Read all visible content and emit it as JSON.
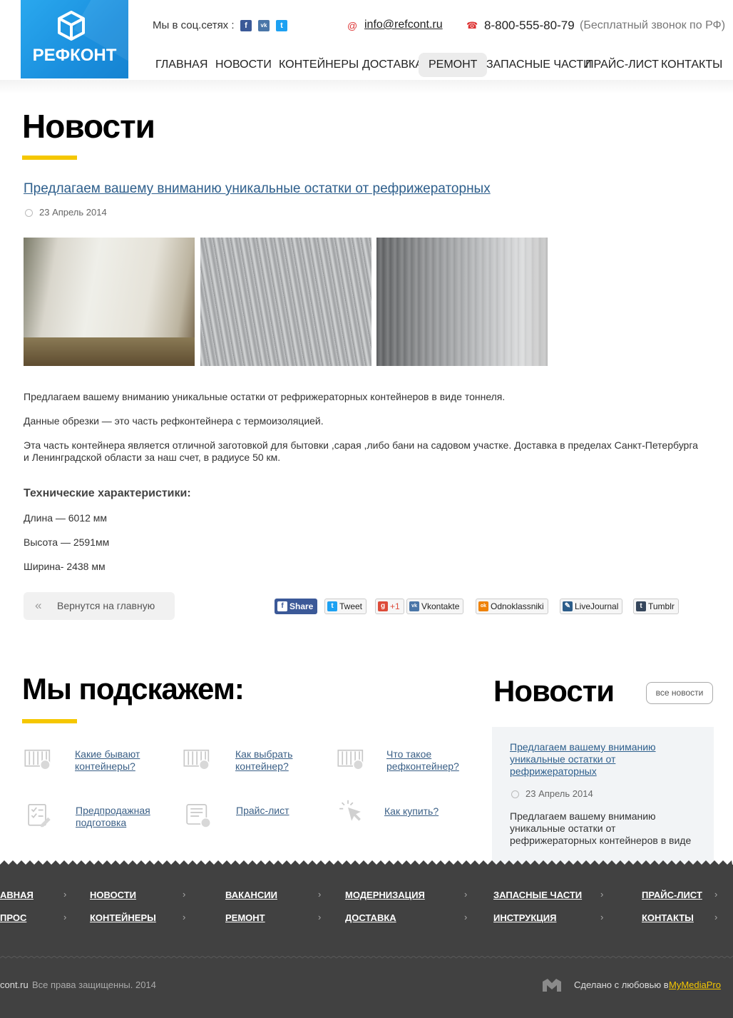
{
  "header": {
    "brand": "РЕФКОНТ",
    "social_label": "Мы в соц.сетях :",
    "social": [
      {
        "icon": "facebook-icon",
        "glyph": "f",
        "color": "#3b5998"
      },
      {
        "icon": "vk-icon",
        "glyph": "vk",
        "color": "#4a76a8"
      },
      {
        "icon": "twitter-icon",
        "glyph": "t",
        "color": "#1da1f2"
      }
    ],
    "email": "info@refcont.ru",
    "phone": "8-800-555-80-79",
    "phone_note": "(Бесплатный звонок по РФ)",
    "nav": [
      "ГЛАВНАЯ",
      "НОВОСТИ",
      "КОНТЕЙНЕРЫ",
      "ДОСТАВКА",
      "РЕМОНТ",
      "ЗАПАСНЫЕ ЧАСТИ",
      "ПРАЙС-ЛИСТ",
      "КОНТАКТЫ"
    ],
    "nav_active": "РЕМОНТ"
  },
  "page": {
    "heading": "Новости"
  },
  "article": {
    "title": "Предлагаем вашему вниманию уникальные остатки от рефрижераторных",
    "date": "23 Апрель 2014",
    "paragraphs": [
      "Предлагаем вашему вниманию уникальные остатки от рефрижераторных контейнеров в виде тоннеля.",
      "Данные обрезки — это часть рефконтейнера с термоизоляцией.",
      "Эта часть контейнера является отличной заготовкой для бытовки ,сарая ,либо бани на садовом участке. Доставка в пределах Санкт-Петербурга и Ленинградской области за наш счет, в радиусе 50 км."
    ],
    "specs_title": "Технические характеристики:",
    "specs": [
      "Длина — 6012 мм",
      "Высота — 2591мм",
      "Ширина- 2438 мм"
    ],
    "back_label": "Вернутся на главную",
    "share": [
      {
        "label": "Share",
        "icon": "facebook-icon",
        "glyph": "f",
        "color": "#3b5998"
      },
      {
        "label": "Tweet",
        "icon": "twitter-icon",
        "glyph": "t",
        "color": "#1da1f2"
      },
      {
        "label": "+1",
        "icon": "googleplus-icon",
        "glyph": "g",
        "color": "#dd4b39"
      },
      {
        "label": "Vkontakte",
        "icon": "vk-icon",
        "glyph": "vk",
        "color": "#4a76a8"
      },
      {
        "label": "Odnoklassniki",
        "icon": "odnoklassniki-icon",
        "glyph": "ok",
        "color": "#ee8208"
      },
      {
        "label": "LiveJournal",
        "icon": "livejournal-icon",
        "glyph": "✎",
        "color": "#2c5d8a"
      },
      {
        "label": "Tumblr",
        "icon": "tumblr-icon",
        "glyph": "t",
        "color": "#35465c"
      }
    ]
  },
  "tips": {
    "heading": "Мы подскажем:",
    "items": [
      {
        "label": "Какие бывают контейнеры?",
        "icon": "container-icon"
      },
      {
        "label": "Как выбрать контейнер?",
        "icon": "container-icon"
      },
      {
        "label": "Что такое рефконтейнер?",
        "icon": "container-icon"
      },
      {
        "label": "Предпродажная подготовка",
        "icon": "checklist-icon"
      },
      {
        "label": "Прайс-лист",
        "icon": "pricelist-icon"
      },
      {
        "label": "Как купить?",
        "icon": "cursor-click-icon"
      }
    ]
  },
  "news_sidebar": {
    "heading": "Новости",
    "all_label": "все новости",
    "item_title": "Предлагаем вашему вниманию уникальные остатки от рефрижераторных",
    "item_date": "23 Апрель 2014",
    "item_text": "Предлагаем вашему вниманию уникальные остатки от рефрижераторных контейнеров в виде"
  },
  "footer": {
    "links_row1": [
      "АВНАЯ",
      "НОВОСТИ",
      "ВАКАНСИИ",
      "МОДЕРНИЗАЦИЯ",
      "ЗАПАСНЫЕ ЧАСТИ",
      "ПРАЙС-ЛИСТ"
    ],
    "links_row2": [
      "ПРОС",
      "КОНТЕЙНЕРЫ",
      "РЕМОНТ",
      "ДОСТАВКА",
      "ИНСТРУКЦИЯ",
      "КОНТАКТЫ"
    ],
    "copyright_site": "cont.ru",
    "copyright_text": "Все права защищенны. 2014",
    "made_with": "Сделано с любовью в",
    "agency": "MyMediaPro"
  }
}
